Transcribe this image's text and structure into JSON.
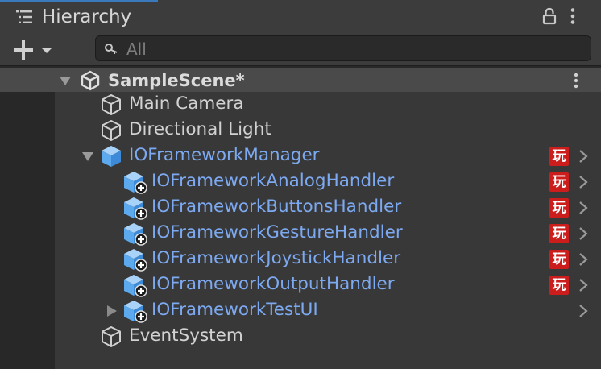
{
  "tab": {
    "title": "Hierarchy"
  },
  "search": {
    "placeholder": "All"
  },
  "scene": {
    "name": "SampleScene*"
  },
  "items": [
    {
      "label": "Main Camera",
      "type": "normal"
    },
    {
      "label": "Directional Light",
      "type": "normal"
    },
    {
      "label": "IOFrameworkManager",
      "type": "prefab"
    },
    {
      "label": "IOFrameworkAnalogHandler",
      "type": "prefab-child"
    },
    {
      "label": "IOFrameworkButtonsHandler",
      "type": "prefab-child"
    },
    {
      "label": "IOFrameworkGestureHandler",
      "type": "prefab-child"
    },
    {
      "label": "IOFrameworkJoystickHandler",
      "type": "prefab-child"
    },
    {
      "label": "IOFrameworkOutputHandler",
      "type": "prefab-child"
    },
    {
      "label": "IOFrameworkTestUI",
      "type": "prefab-child"
    },
    {
      "label": "EventSystem",
      "type": "normal"
    }
  ],
  "badge": {
    "text": "玩"
  },
  "colors": {
    "prefab_text": "#7da9f1",
    "badge": "#cc1d1d",
    "accent": "#3a79bb"
  },
  "icons": {
    "tab": "list-icon",
    "lock": "lock-icon",
    "menu": "kebab-icon",
    "create": "plus-icon",
    "search": "search-icon",
    "scene": "unity-logo-icon",
    "gameobject": "cube-outline-icon",
    "prefab": "prefab-cube-icon",
    "expand": "triangle-icon",
    "chevron": "chevron-right-icon"
  }
}
